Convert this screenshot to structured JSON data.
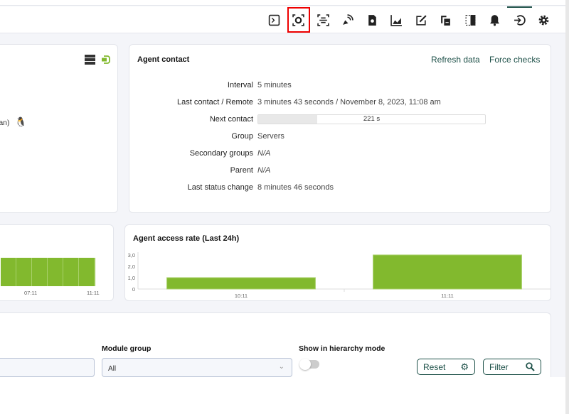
{
  "toolbar": {
    "icons": [
      "terminal-icon",
      "eye-target-icon",
      "scan-icon",
      "satellite-dish-icon",
      "shield-file-icon",
      "area-chart-icon",
      "edit-icon",
      "copy-icon",
      "split-panel-icon",
      "bell-icon",
      "login-icon",
      "gear-icon"
    ],
    "selected": "eye-target-icon",
    "active": "login-icon"
  },
  "agent_panel": {
    "os_text": "ian)",
    "icons": [
      "server-icon",
      "agent-status-icon"
    ]
  },
  "agent_contact": {
    "title": "Agent contact",
    "refresh": "Refresh data",
    "force": "Force checks",
    "rows": [
      {
        "label": "Interval",
        "value": "5 minutes"
      },
      {
        "label": "Last contact / Remote",
        "value": "3 minutes 43 seconds / November 8, 2023, 11:08 am"
      },
      {
        "label": "Next contact",
        "value": "221 s",
        "progress_percent": 26
      },
      {
        "label": "Group",
        "value": "Servers"
      },
      {
        "label": "Secondary groups",
        "value": "N/A"
      },
      {
        "label": "Parent",
        "value": "N/A"
      },
      {
        "label": "Last status change",
        "value": "8 minutes 46 seconds"
      }
    ]
  },
  "chart_data": [
    {
      "type": "bar",
      "title": "",
      "categories": [
        "07:11",
        "11:11"
      ],
      "note_partial": true,
      "bar_color": "#82b92e"
    },
    {
      "type": "bar",
      "title": "Agent access rate (Last 24h)",
      "categories": [
        "10:11",
        "11:11"
      ],
      "values": [
        1,
        3
      ],
      "yticks": [
        "0",
        "1,0",
        "2,0",
        "3,0"
      ],
      "ylim": [
        0,
        3
      ],
      "bar_color": "#82b92e"
    }
  ],
  "filters": {
    "module_group_label": "Module group",
    "module_group_value": "All",
    "hierarchy_label": "Show in hierarchy mode",
    "hierarchy_on": false,
    "reset": "Reset",
    "filter": "Filter"
  }
}
